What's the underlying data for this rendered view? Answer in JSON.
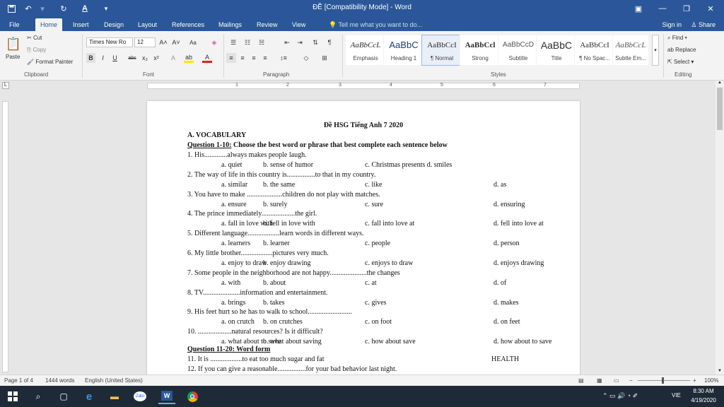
{
  "window": {
    "title": "ĐỀ [Compatibility Mode] - Word",
    "quick_access": [
      "save-icon",
      "undo-icon",
      "redo-icon",
      "font-color-icon",
      "customize-icon"
    ]
  },
  "tabs": [
    "File",
    "Home",
    "Insert",
    "Design",
    "Layout",
    "References",
    "Mailings",
    "Review",
    "View"
  ],
  "active_tab": "Home",
  "tell_me_placeholder": "Tell me what you want to do...",
  "sign_in": "Sign in",
  "share": "Share",
  "ribbon": {
    "clipboard": {
      "paste": "Paste",
      "cut": "Cut",
      "copy": "Copy",
      "format_painter": "Format Painter",
      "label": "Clipboard"
    },
    "font": {
      "font_name": "Times New Ro",
      "font_size": "12",
      "label": "Font",
      "aa": "Aa",
      "bold": "B",
      "italic": "I",
      "underline": "U",
      "strike": "abc",
      "sub": "x₂",
      "sup": "x²"
    },
    "paragraph": {
      "label": "Paragraph"
    },
    "styles": {
      "label": "Styles",
      "items": [
        {
          "sample": "AaBbCcL",
          "name": "Emphasis"
        },
        {
          "sample": "AaBbC",
          "name": "Heading 1"
        },
        {
          "sample": "AaBbCcI",
          "name": "¶ Normal"
        },
        {
          "sample": "AaBbCcl",
          "name": "Strong"
        },
        {
          "sample": "AaBbCcD",
          "name": "Subtitle"
        },
        {
          "sample": "AaBbC",
          "name": "Title"
        },
        {
          "sample": "AaBbCcI",
          "name": "¶ No Spac..."
        },
        {
          "sample": "AaBbCcL",
          "name": "Subtle Em..."
        }
      ]
    },
    "editing": {
      "find": "Find",
      "replace": "Replace",
      "select": "Select",
      "label": "Editing"
    }
  },
  "ruler": {
    "numbers": [
      "1",
      "2",
      "3",
      "4",
      "5",
      "6",
      "7"
    ]
  },
  "document": {
    "title": "Đề HSG Tiếng Anh 7 2020",
    "section_a": "A. VOCABULARY",
    "q1_heading": "Question 1-10:",
    "q1_instruction": " Choose the best word or phrase that best complete each sentence below",
    "questions": [
      {
        "stem": "1. His.............always makes people laugh.",
        "options": [
          "a. quiet",
          "b. sense of humor",
          "c. Christmas presents  d. smiles",
          ""
        ]
      },
      {
        "stem": "2. The way of life in this country is................to that in my country.",
        "options": [
          "a. similar",
          "b. the same",
          "c. like",
          "d. as"
        ]
      },
      {
        "stem": "3. You have to make ....................children do not play with matches.",
        "options": [
          "a. ensure",
          "b. surely",
          "c. sure",
          "d. ensuring"
        ]
      },
      {
        "stem": "4. The prince immediately...................the girl.",
        "options": [
          "a. fall in love with",
          "b. fell in love with",
          "c. fall into love at",
          "d. fell into love at"
        ]
      },
      {
        "stem": "5. Different language..................learn words in different ways.",
        "options": [
          "a. learners",
          "b. learner",
          "c. people",
          "d. person"
        ]
      },
      {
        "stem": "6. My little brother..................pictures very much.",
        "options": [
          "a. enjoy to draw",
          "b. enjoy drawing",
          "c. enjoys to draw",
          "d. enjoys drawing"
        ]
      },
      {
        "stem": "7. Some people in the neighborhood are not happy.....................the changes",
        "options": [
          "a. with",
          "b. about",
          "c. at",
          "d. of"
        ]
      },
      {
        "stem": "8. TV.....................information and entertainment.",
        "options": [
          "a. brings",
          "b. takes",
          "c. gives",
          "d. makes"
        ]
      },
      {
        "stem": "9. His feet hurt so he has to walk to school.........................",
        "options": [
          "a. on crutch",
          "b. on crutches",
          "c. on foot",
          "d. on feet"
        ]
      },
      {
        "stem": "10. ...................natural resources? Is it difficult?",
        "options": [
          "a. what about to save",
          "b. what about saving",
          "c. how about save",
          "d. how about to save"
        ]
      }
    ],
    "q2_heading": "Question 11-20: Word form",
    "q11": "11. It is ..................to eat too much sugar and fat",
    "q11_word": "HEALTH",
    "q12": "12. If you can give a reasonable................for your bad behavior last night."
  },
  "status": {
    "page": "Page 1 of 4",
    "words": "1444 words",
    "language": "English (United States)",
    "zoom": "100%"
  },
  "taskbar": {
    "time": "8:30 AM",
    "date": "4/19/2020",
    "lang": "VIE"
  }
}
